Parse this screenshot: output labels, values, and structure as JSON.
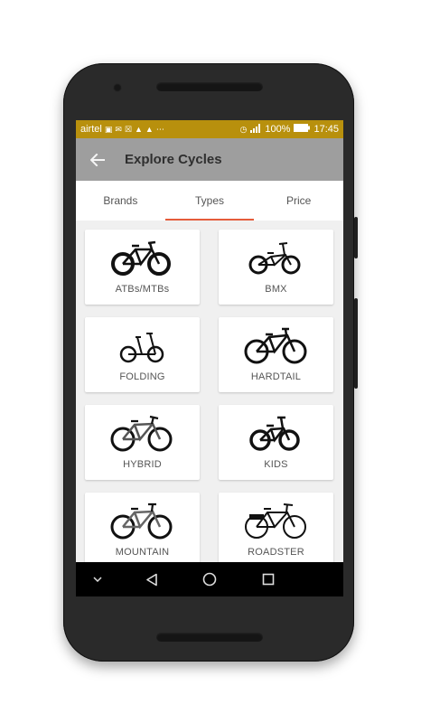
{
  "status_bar": {
    "carrier": "airtel",
    "battery": "100%",
    "time": "17:45",
    "bg_color": "#b8900d",
    "icons": [
      "gallery-icon",
      "mail-icon",
      "signal-off-icon",
      "warning-icon",
      "warning-icon",
      "more-icon",
      "alarm-icon",
      "4g-signal-icon",
      "battery-icon"
    ]
  },
  "app_bar": {
    "title": "Explore Cycles",
    "bg_color": "#9e9e9e",
    "back_icon": "arrow-back-icon"
  },
  "tabs": {
    "items": [
      {
        "label": "Brands",
        "active": false
      },
      {
        "label": "Types",
        "active": true
      },
      {
        "label": "Price",
        "active": false
      }
    ],
    "indicator_color": "#e55c3a"
  },
  "cycle_types": [
    {
      "label": "ATBs/MTBs",
      "icon": "mtb-bicycle-image"
    },
    {
      "label": "BMX",
      "icon": "bmx-bicycle-image"
    },
    {
      "label": "FOLDING",
      "icon": "folding-bicycle-image"
    },
    {
      "label": "HARDTAIL",
      "icon": "hardtail-bicycle-image"
    },
    {
      "label": "HYBRID",
      "icon": "hybrid-bicycle-image"
    },
    {
      "label": "KIDS",
      "icon": "kids-bicycle-image"
    },
    {
      "label": "MOUNTAIN",
      "icon": "mountain-bicycle-image"
    },
    {
      "label": "ROADSTER",
      "icon": "roadster-bicycle-image"
    }
  ],
  "nav_bar": {
    "icons": [
      "chevron-down-icon",
      "back-triangle-icon",
      "home-circle-icon",
      "recents-square-icon"
    ]
  }
}
